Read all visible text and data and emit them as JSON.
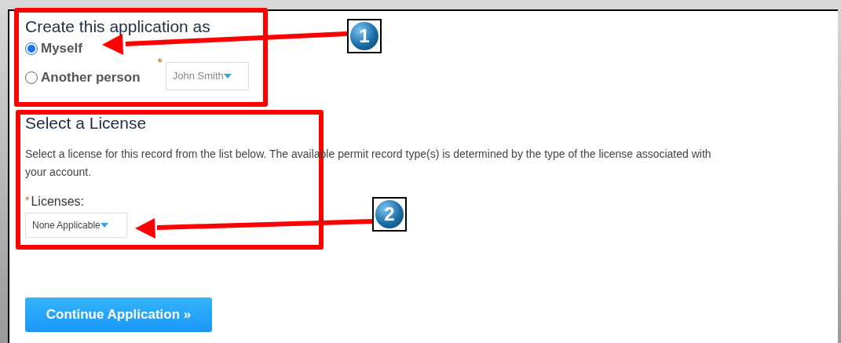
{
  "applicant": {
    "title": "Create this application as",
    "options": [
      {
        "label": "Myself",
        "selected": true
      },
      {
        "label": "Another person",
        "selected": false
      }
    ],
    "person_select": {
      "required_mark": "*",
      "value": "John Smith"
    }
  },
  "license": {
    "title": "Select a License",
    "description": "Select a license for this record from the list below. The available permit record type(s) is determined by the type of the license associated with your account.",
    "field_label": "Licenses:",
    "required_mark": "*",
    "value": "None Applicable"
  },
  "continue_button": "Continue Application »",
  "callouts": [
    {
      "label": "1"
    },
    {
      "label": "2"
    }
  ]
}
